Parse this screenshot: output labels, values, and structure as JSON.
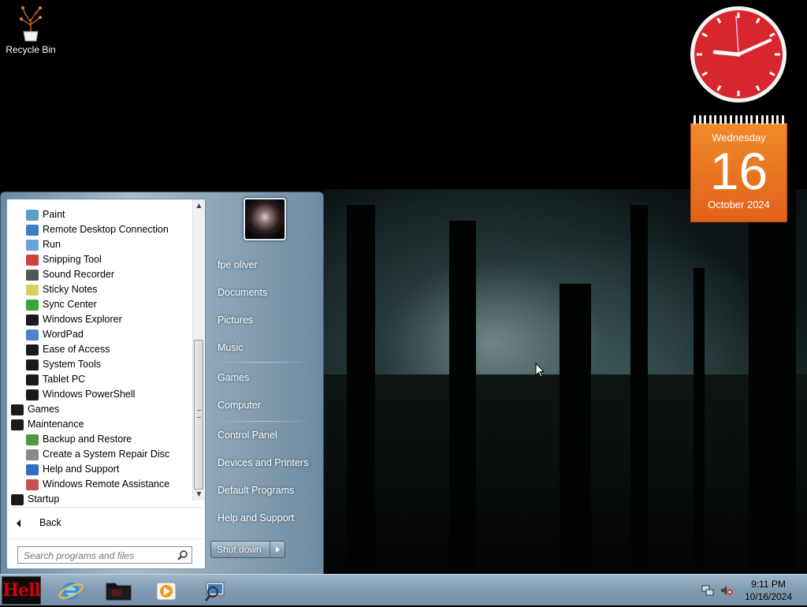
{
  "desktop": {
    "icons": [
      {
        "label": "Recycle Bin",
        "icon": "recycle-bin-icon"
      }
    ]
  },
  "gadgets": {
    "clock": {
      "hours": 9,
      "minutes": 11,
      "face_color": "#d8262f"
    },
    "calendar": {
      "weekday": "Wednesday",
      "day": "16",
      "month_year": "October 2024",
      "color": "#e86f1f"
    }
  },
  "start_menu": {
    "programs": [
      {
        "label": "Paint",
        "indent": true,
        "icon": "paint-icon",
        "color": "#5da0c8"
      },
      {
        "label": "Remote Desktop Connection",
        "indent": true,
        "icon": "remote-desktop-icon",
        "color": "#3f7fc0"
      },
      {
        "label": "Run",
        "indent": true,
        "icon": "run-icon",
        "color": "#6aa1d8"
      },
      {
        "label": "Snipping Tool",
        "indent": true,
        "icon": "scissors-icon",
        "color": "#d04040"
      },
      {
        "label": "Sound Recorder",
        "indent": true,
        "icon": "microphone-icon",
        "color": "#555555"
      },
      {
        "label": "Sticky Notes",
        "indent": true,
        "icon": "sticky-note-icon",
        "color": "#d6d35a"
      },
      {
        "label": "Sync Center",
        "indent": true,
        "icon": "sync-icon",
        "color": "#3da33d"
      },
      {
        "label": "Windows Explorer",
        "indent": true,
        "icon": "folder-icon",
        "color": "#1a1a1a"
      },
      {
        "label": "WordPad",
        "indent": true,
        "icon": "wordpad-icon",
        "color": "#4f84c4"
      },
      {
        "label": "Ease of Access",
        "indent": true,
        "icon": "folder-icon",
        "color": "#1a1a1a"
      },
      {
        "label": "System Tools",
        "indent": true,
        "icon": "folder-icon",
        "color": "#1a1a1a"
      },
      {
        "label": "Tablet PC",
        "indent": true,
        "icon": "folder-icon",
        "color": "#1a1a1a"
      },
      {
        "label": "Windows PowerShell",
        "indent": true,
        "icon": "folder-icon",
        "color": "#1a1a1a"
      },
      {
        "label": "Games",
        "indent": false,
        "icon": "folder-icon",
        "color": "#1a1a1a"
      },
      {
        "label": "Maintenance",
        "indent": false,
        "icon": "folder-icon",
        "color": "#1a1a1a"
      },
      {
        "label": "Backup and Restore",
        "indent": true,
        "icon": "backup-icon",
        "color": "#4c9a3c"
      },
      {
        "label": "Create a System Repair Disc",
        "indent": true,
        "icon": "repair-disc-icon",
        "color": "#8a8a8a"
      },
      {
        "label": "Help and Support",
        "indent": true,
        "icon": "help-icon",
        "color": "#2f6fc1"
      },
      {
        "label": "Windows Remote Assistance",
        "indent": true,
        "icon": "remote-assistance-icon",
        "color": "#c85050"
      },
      {
        "label": "Startup",
        "indent": false,
        "icon": "folder-icon",
        "color": "#1a1a1a"
      }
    ],
    "back_label": "Back",
    "search_placeholder": "Search programs and files",
    "right_items": [
      {
        "label": "fpe oliver"
      },
      {
        "label": "Documents"
      },
      {
        "label": "Pictures"
      },
      {
        "label": "Music"
      },
      {
        "label": "Games"
      },
      {
        "label": "Computer"
      },
      {
        "label": "Control Panel"
      },
      {
        "label": "Devices and Printers"
      },
      {
        "label": "Default Programs"
      },
      {
        "label": "Help and Support"
      }
    ],
    "shutdown_label": "Shut down"
  },
  "taskbar": {
    "start_label": "Hell",
    "pinned": [
      {
        "name": "internet-explorer-icon"
      },
      {
        "name": "windows-explorer-icon"
      },
      {
        "name": "media-player-icon"
      },
      {
        "name": "search-computer-icon"
      }
    ],
    "tray": {
      "time": "9:11 PM",
      "date": "10/16/2024"
    }
  }
}
